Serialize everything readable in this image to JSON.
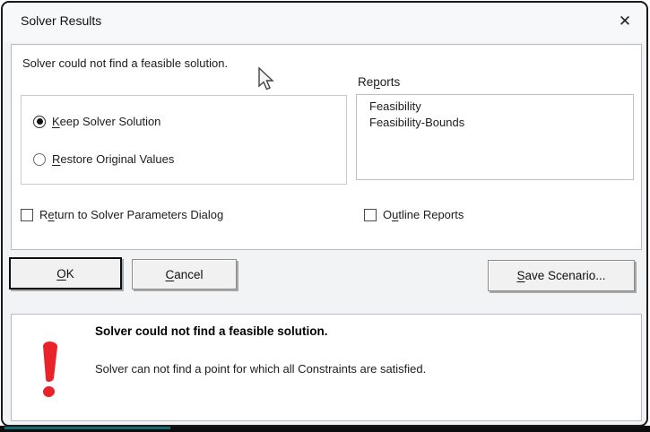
{
  "window": {
    "title": "Solver Results",
    "close_glyph": "✕"
  },
  "main": {
    "status_message": "Solver could not find a feasible solution.",
    "options": [
      {
        "pre": "",
        "key": "K",
        "post": "eep Solver Solution",
        "selected": true
      },
      {
        "pre": "",
        "key": "R",
        "post": "estore Original Values",
        "selected": false
      }
    ],
    "reports": {
      "label_pre": "Re",
      "label_key": "p",
      "label_post": "orts",
      "items": [
        "Feasibility",
        "Feasibility-Bounds"
      ]
    },
    "checkboxes": [
      {
        "pre": "R",
        "key": "e",
        "post": "turn to Solver Parameters Dialog",
        "checked": false
      },
      {
        "pre": "O",
        "key": "u",
        "post": "tline Reports",
        "checked": false
      }
    ]
  },
  "buttons": {
    "ok": {
      "pre": "",
      "key": "O",
      "post": "K"
    },
    "cancel": {
      "pre": "",
      "key": "C",
      "post": "ancel"
    },
    "save_scenario": {
      "pre": "",
      "key": "S",
      "post": "ave Scenario..."
    }
  },
  "footer": {
    "heading": "Solver could not find a feasible solution.",
    "description": "Solver can not find a point for which all Constraints are satisfied."
  },
  "colors": {
    "warning_red": "#e8232a",
    "edge_teal": "#156a72",
    "edge_black": "#0d0d0d",
    "panel_border": "#b6bcc2"
  }
}
